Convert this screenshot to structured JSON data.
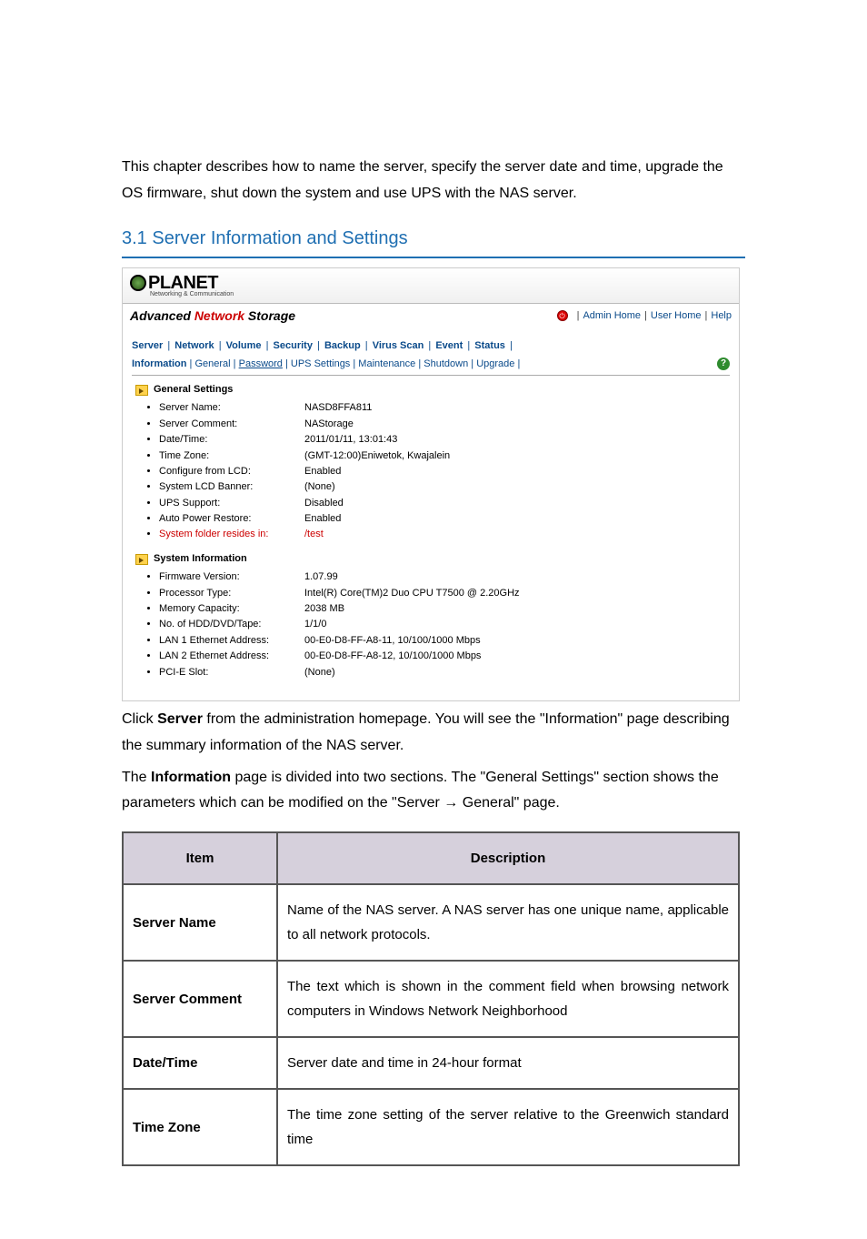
{
  "intro": "This chapter describes how to name the server, specify the server date and time, upgrade the OS firmware, shut down the system and use UPS with the NAS server.",
  "section_title": "3.1 Server Information and Settings",
  "panel": {
    "logo_main": "PLANET",
    "logo_sub": "Networking & Communication",
    "product_prefix": "Advanced ",
    "product_highlight": "Network",
    "product_suffix": " Storage",
    "links": {
      "admin_home": "Admin Home",
      "user_home": "User Home",
      "help": "Help",
      "sep": "|"
    },
    "tabs1": [
      "Server",
      "Network",
      "Volume",
      "Security",
      "Backup",
      "Virus Scan",
      "Event",
      "Status"
    ],
    "tabs2": {
      "active": "Information",
      "rest": [
        "General",
        "Password",
        "UPS Settings",
        "Maintenance",
        "Shutdown",
        "Upgrade"
      ],
      "linked_index": 1
    },
    "group1_title": "General Settings",
    "group1": [
      {
        "k": "Server Name:",
        "v": "NASD8FFA811"
      },
      {
        "k": "Server Comment:",
        "v": "NAStorage"
      },
      {
        "k": "Date/Time:",
        "v": "2011/01/11, 13:01:43"
      },
      {
        "k": "Time Zone:",
        "v": "(GMT-12:00)Eniwetok, Kwajalein"
      },
      {
        "k": "Configure from LCD:",
        "v": "Enabled"
      },
      {
        "k": "System LCD Banner:",
        "v": "(None)"
      },
      {
        "k": "UPS Support:",
        "v": "Disabled"
      },
      {
        "k": "Auto Power Restore:",
        "v": "Enabled"
      },
      {
        "k": "System folder resides in:",
        "v": "/test",
        "red": true
      }
    ],
    "group2_title": "System Information",
    "group2": [
      {
        "k": "Firmware Version:",
        "v": "1.07.99"
      },
      {
        "k": "Processor Type:",
        "v": "Intel(R) Core(TM)2 Duo CPU T7500 @ 2.20GHz"
      },
      {
        "k": "Memory Capacity:",
        "v": "2038 MB"
      },
      {
        "k": "No. of HDD/DVD/Tape:",
        "v": "1/1/0"
      },
      {
        "k": "LAN 1 Ethernet Address:",
        "v": "00-E0-D8-FF-A8-11, 10/100/1000 Mbps"
      },
      {
        "k": "LAN 2 Ethernet Address:",
        "v": "00-E0-D8-FF-A8-12, 10/100/1000 Mbps"
      },
      {
        "k": "PCI-E Slot:",
        "v": "(None)"
      }
    ]
  },
  "body_text_1a": "Click ",
  "body_text_1b": "Server",
  "body_text_1c": " from the administration homepage. You will see the \"Information\" page describing the summary information of the NAS server.",
  "body_text_2a": "The ",
  "body_text_2b": "Information",
  "body_text_2c": " page is divided into two sections. The \"General Settings\" section shows the parameters which can be modified on the \"Server → General\" page.",
  "table": {
    "headers": {
      "item": "Item",
      "desc": "Description"
    },
    "rows": [
      {
        "item": "Server Name",
        "desc": "Name of the NAS server. A NAS server has one unique name, applicable to all network protocols."
      },
      {
        "item": "Server Comment",
        "desc": "The text which is shown in the comment field when browsing network computers in Windows Network Neighborhood"
      },
      {
        "item": "Date/Time",
        "desc": "Server date and time in 24-hour format"
      },
      {
        "item": "Time Zone",
        "desc": "The time zone setting of the server relative to the Greenwich standard time"
      }
    ]
  }
}
